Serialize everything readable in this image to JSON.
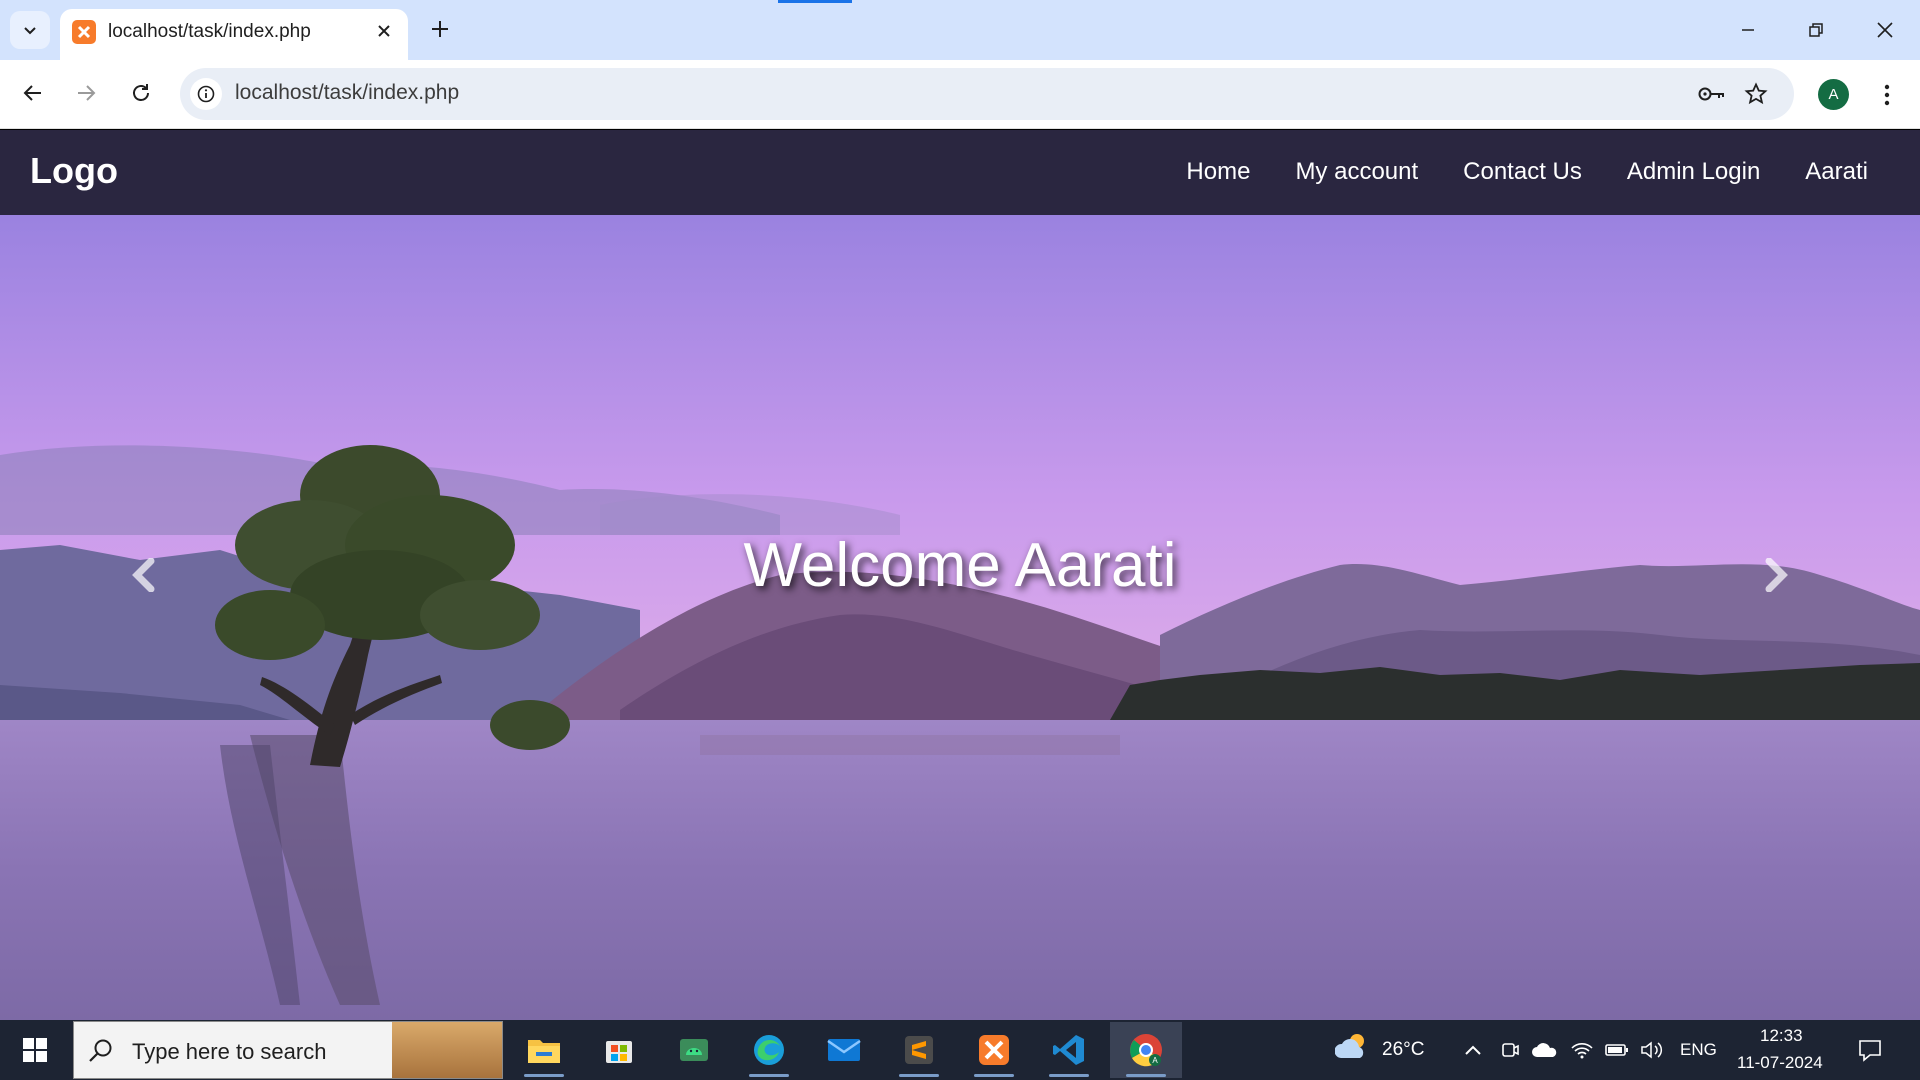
{
  "browser": {
    "tab": {
      "title": "localhost/task/index.php"
    },
    "url": "localhost/task/index.php",
    "profile_initial": "A"
  },
  "site": {
    "logo": "Logo",
    "nav": [
      "Home",
      "My account",
      "Contact Us",
      "Admin Login",
      "Aarati"
    ],
    "hero_text": "Welcome Aarati",
    "accent_colors": {
      "navbar": "#2a2640",
      "sky": "#c59be8",
      "lake": "#8e78b8"
    }
  },
  "taskbar": {
    "search_placeholder": "Type here to search",
    "weather_temp": "26°C",
    "language": "ENG",
    "time": "12:33",
    "date": "11-07-2024",
    "apps": [
      "file-explorer-icon",
      "microsoft-store-icon",
      "android-studio-icon",
      "edge-icon",
      "mail-icon",
      "sublime-text-icon",
      "xampp-icon",
      "vscode-icon",
      "chrome-icon"
    ]
  }
}
